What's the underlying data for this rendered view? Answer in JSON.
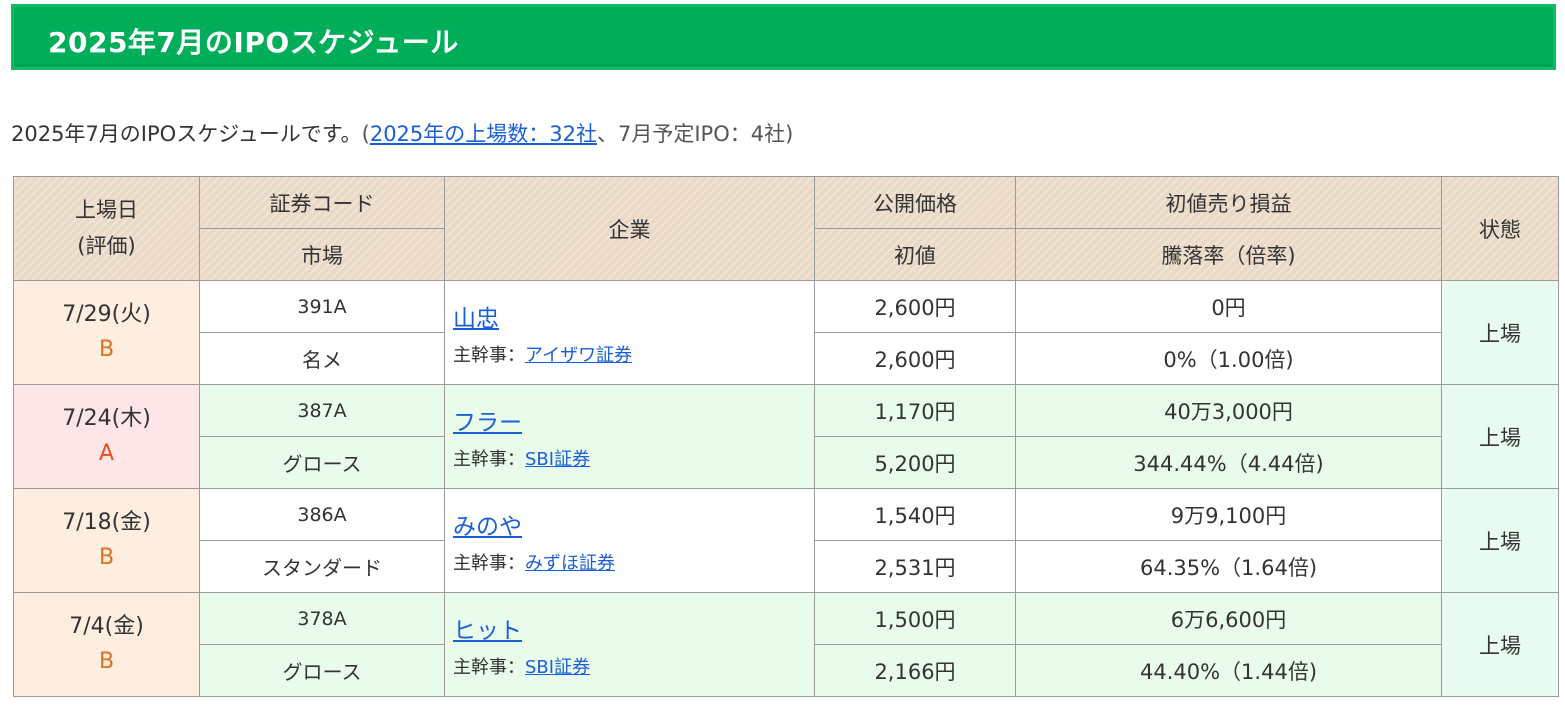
{
  "page_title": "2025年7月のIPOスケジュール",
  "intro": {
    "text": "2025年7月のIPOスケジュールです。",
    "paren_open": "(",
    "link": "2025年の上場数：32社",
    "after": "、7月予定IPO：4社",
    "paren_close": ")"
  },
  "table": {
    "headers": {
      "listing_date": "上場日",
      "rating": "(評価)",
      "code": "証券コード",
      "market": "市場",
      "company": "企業",
      "offer_price": "公開価格",
      "first_price": "初値",
      "profit": "初値売り損益",
      "rate": "騰落率（倍率)",
      "status": "状態"
    },
    "lead_label": "主幹事：",
    "rows": [
      {
        "date": "7/29(火)",
        "rank": "B",
        "code": "391A",
        "market": "名メ",
        "company": "山忠",
        "lead": "アイザワ証券",
        "offer_price": "2,600円",
        "first_price": "2,600円",
        "profit": "0円",
        "rate": "0%（1.00倍)",
        "status": "上場"
      },
      {
        "date": "7/24(木)",
        "rank": "A",
        "code": "387A",
        "market": "グロース",
        "company": "フラー",
        "lead": "SBI証券",
        "offer_price": "1,170円",
        "first_price": "5,200円",
        "profit": "40万3,000円",
        "rate": "344.44%（4.44倍)",
        "status": "上場"
      },
      {
        "date": "7/18(金)",
        "rank": "B",
        "code": "386A",
        "market": "スタンダード",
        "company": "みのや",
        "lead": "みずほ証券",
        "offer_price": "1,540円",
        "first_price": "2,531円",
        "profit": "9万9,100円",
        "rate": "64.35%（1.64倍)",
        "status": "上場"
      },
      {
        "date": "7/4(金)",
        "rank": "B",
        "code": "378A",
        "market": "グロース",
        "company": "ヒット",
        "lead": "SBI証券",
        "offer_price": "1,500円",
        "first_price": "2,166円",
        "profit": "6万6,600円",
        "rate": "44.40%（1.44倍)",
        "status": "上場"
      }
    ]
  },
  "colors": {
    "title_bar": "#00ae5a",
    "header_bg": "#ead9c6",
    "link": "#1a5fd6",
    "profit_positive": "#e01010",
    "profit_zero": "#6060c0",
    "rank_B": "#d9731f",
    "rank_A": "#e8501d"
  }
}
